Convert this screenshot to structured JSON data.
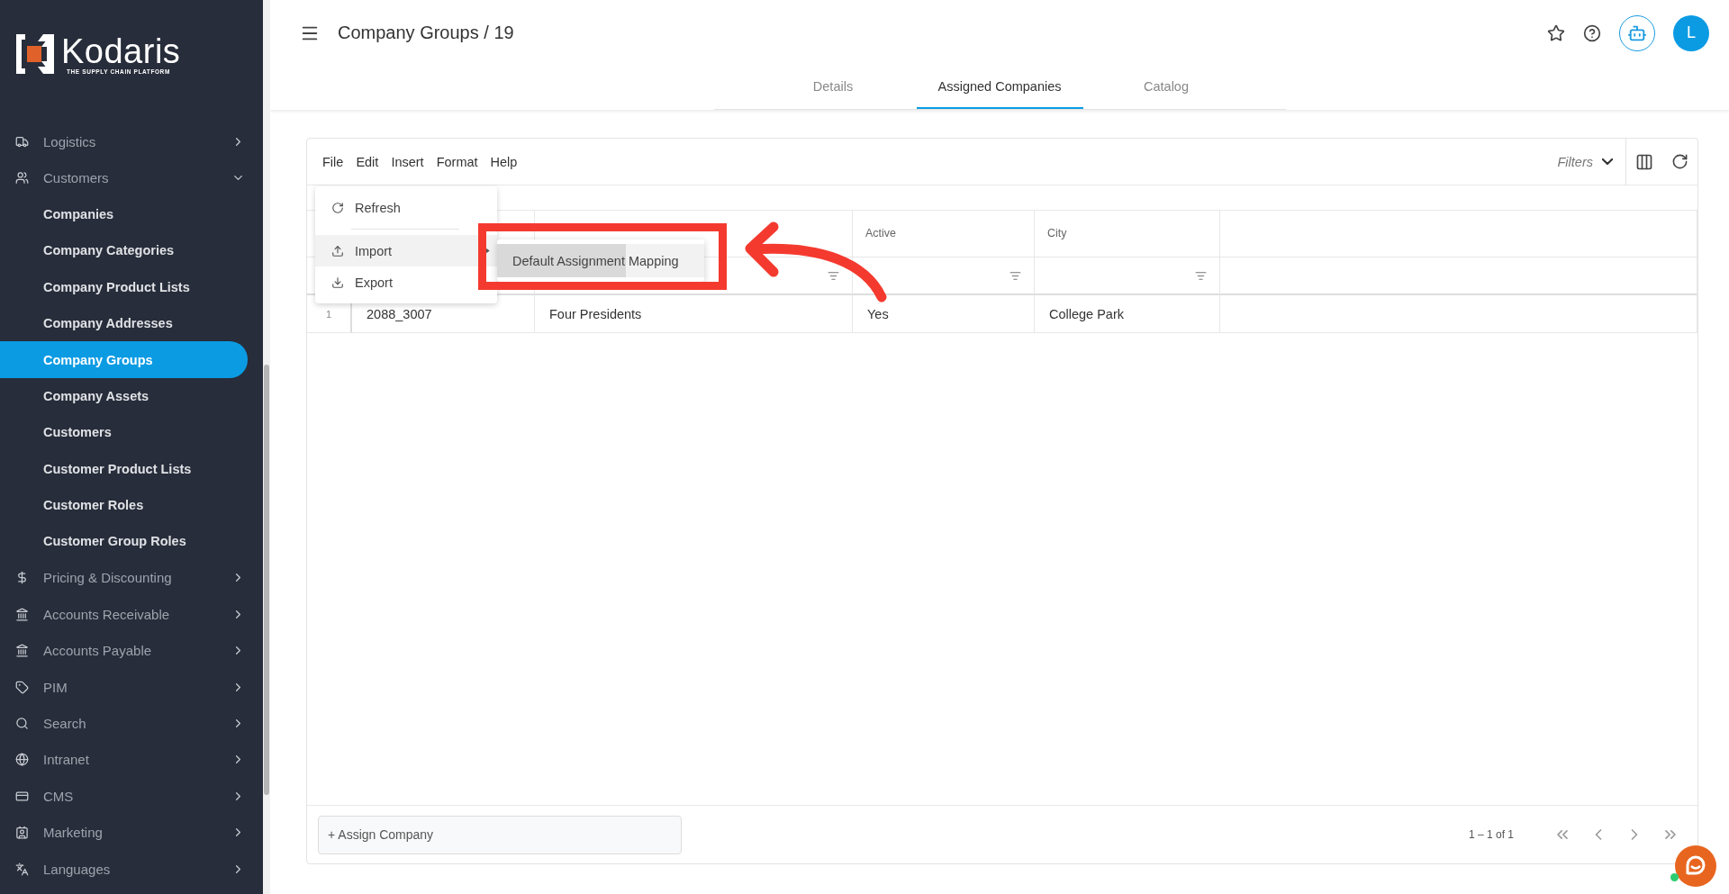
{
  "sidebar": {
    "logo": {
      "name": "Kodaris",
      "tagline": "THE SUPPLY CHAIN PLATFORM"
    },
    "items": [
      {
        "kind": "section",
        "label": "Logistics",
        "expanded": false
      },
      {
        "kind": "section",
        "label": "Customers",
        "expanded": true,
        "children": [
          {
            "label": "Companies",
            "selected": false
          },
          {
            "label": "Company Categories",
            "selected": false
          },
          {
            "label": "Company Product Lists",
            "selected": false
          },
          {
            "label": "Company Addresses",
            "selected": false
          },
          {
            "label": "Company Groups",
            "selected": true
          },
          {
            "label": "Company Assets",
            "selected": false
          },
          {
            "label": "Customers",
            "selected": false
          },
          {
            "label": "Customer Product Lists",
            "selected": false
          },
          {
            "label": "Customer Roles",
            "selected": false
          },
          {
            "label": "Customer Group Roles",
            "selected": false
          }
        ]
      },
      {
        "kind": "section",
        "label": "Pricing & Discounting",
        "expanded": false
      },
      {
        "kind": "section",
        "label": "Accounts Receivable",
        "expanded": false
      },
      {
        "kind": "section",
        "label": "Accounts Payable",
        "expanded": false
      },
      {
        "kind": "section",
        "label": "PIM",
        "expanded": false
      },
      {
        "kind": "section",
        "label": "Search",
        "expanded": false
      },
      {
        "kind": "section",
        "label": "Intranet",
        "expanded": false
      },
      {
        "kind": "section",
        "label": "CMS",
        "expanded": false
      },
      {
        "kind": "section",
        "label": "Marketing",
        "expanded": false
      },
      {
        "kind": "section",
        "label": "Languages",
        "expanded": false
      }
    ]
  },
  "header": {
    "title": "Company Groups / 19",
    "avatar": "L"
  },
  "tabs": [
    {
      "label": "Details",
      "selected": false
    },
    {
      "label": "Assigned Companies",
      "selected": true
    },
    {
      "label": "Catalog",
      "selected": false
    }
  ],
  "toolbar": {
    "menus": [
      "File",
      "Edit",
      "Insert",
      "Format",
      "Help"
    ],
    "filters": "Filters"
  },
  "table": {
    "columns": [
      {
        "filterable": false
      },
      {
        "filterable": true
      },
      {
        "label": "Active",
        "filterable": true
      },
      {
        "label": "City",
        "filterable": true
      },
      {
        "filterable": false
      }
    ],
    "rows": [
      {
        "number": "1",
        "cells": [
          "2088_3007",
          "Four Presidents",
          "Yes",
          "College Park"
        ]
      }
    ]
  },
  "file_menu": {
    "items": [
      {
        "kind": "item",
        "label": "Refresh",
        "highlighted": false,
        "submenu": false
      },
      {
        "kind": "divider"
      },
      {
        "kind": "item",
        "label": "Import",
        "highlighted": true,
        "submenu": true
      },
      {
        "kind": "item",
        "label": "Export",
        "highlighted": false,
        "submenu": false
      }
    ],
    "submenu": [
      {
        "label": "Default Assignment Mapping",
        "level": 0.62
      }
    ]
  },
  "annotation": {
    "highlight_box": true,
    "arrow": true
  },
  "footer": {
    "assign_button": "+ Assign Company",
    "range": "1 – 1 of 1"
  }
}
